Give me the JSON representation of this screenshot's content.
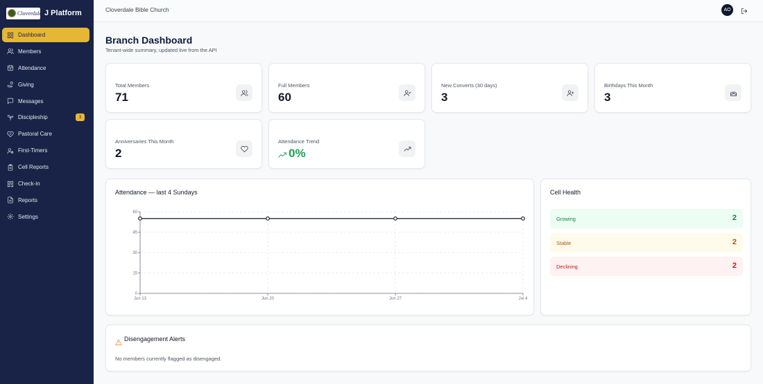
{
  "sidebar": {
    "logo_text": "Cloverdale",
    "brand": "J Platform",
    "items": [
      {
        "label": "Dashboard",
        "icon": "grid-icon",
        "active": true
      },
      {
        "label": "Members",
        "icon": "users-icon"
      },
      {
        "label": "Attendance",
        "icon": "calendar-check-icon"
      },
      {
        "label": "Giving",
        "icon": "hand-coins-icon"
      },
      {
        "label": "Messages",
        "icon": "message-square-icon"
      },
      {
        "label": "Discipleship",
        "icon": "sprout-icon",
        "badge": "3"
      },
      {
        "label": "Pastoral Care",
        "icon": "heart-handshake-icon"
      },
      {
        "label": "First-Timers",
        "icon": "user-star-icon"
      },
      {
        "label": "Cell Reports",
        "icon": "clipboard-icon"
      },
      {
        "label": "Check-in",
        "icon": "qr-code-icon"
      },
      {
        "label": "Reports",
        "icon": "file-text-icon"
      },
      {
        "label": "Settings",
        "icon": "gear-icon"
      }
    ]
  },
  "header": {
    "org_name": "Cloverdale Bible Church",
    "avatar_initials": "AO"
  },
  "page": {
    "title": "Branch Dashboard",
    "subtitle": "Tenant-wide summary, updated live from the API"
  },
  "stats": {
    "total_members": {
      "label": "Total Members",
      "value": "71"
    },
    "full_members": {
      "label": "Full Members",
      "value": "60"
    },
    "new_converts": {
      "label": "New Converts (30 days)",
      "value": "3"
    },
    "birthdays": {
      "label": "Birthdays This Month",
      "value": "3"
    },
    "anniversaries": {
      "label": "Anniversaries This Month",
      "value": "2"
    },
    "attendance_trend": {
      "label": "Attendance Trend",
      "value": "0%"
    }
  },
  "attendance_chart": {
    "title": "Attendance — last 4 Sundays"
  },
  "chart_data": {
    "type": "line",
    "x": [
      "Jun 13",
      "Jun 20",
      "Jun 27",
      "Jul 4"
    ],
    "values": [
      55,
      55,
      55,
      55
    ],
    "ylim": [
      0,
      60
    ],
    "yticks": [
      0,
      15,
      30,
      45,
      60
    ],
    "grid": true,
    "line_color": "#1f2937"
  },
  "cell_health": {
    "title": "Cell Health",
    "rows": [
      {
        "label": "Growing",
        "count": "2",
        "bg": "#ecfdf3",
        "color": "#15803d"
      },
      {
        "label": "Stable",
        "count": "2",
        "bg": "#fffbeb",
        "color": "#b45309"
      },
      {
        "label": "Declining",
        "count": "2",
        "bg": "#fef2f2",
        "color": "#b91c1c"
      }
    ]
  },
  "alerts": {
    "title": "Disengagement Alerts",
    "empty_text": "No members currently flagged as disengaged."
  },
  "colors": {
    "sidebar_bg": "#182347",
    "accent": "#e6b635",
    "trend_green": "#1f9d55"
  }
}
